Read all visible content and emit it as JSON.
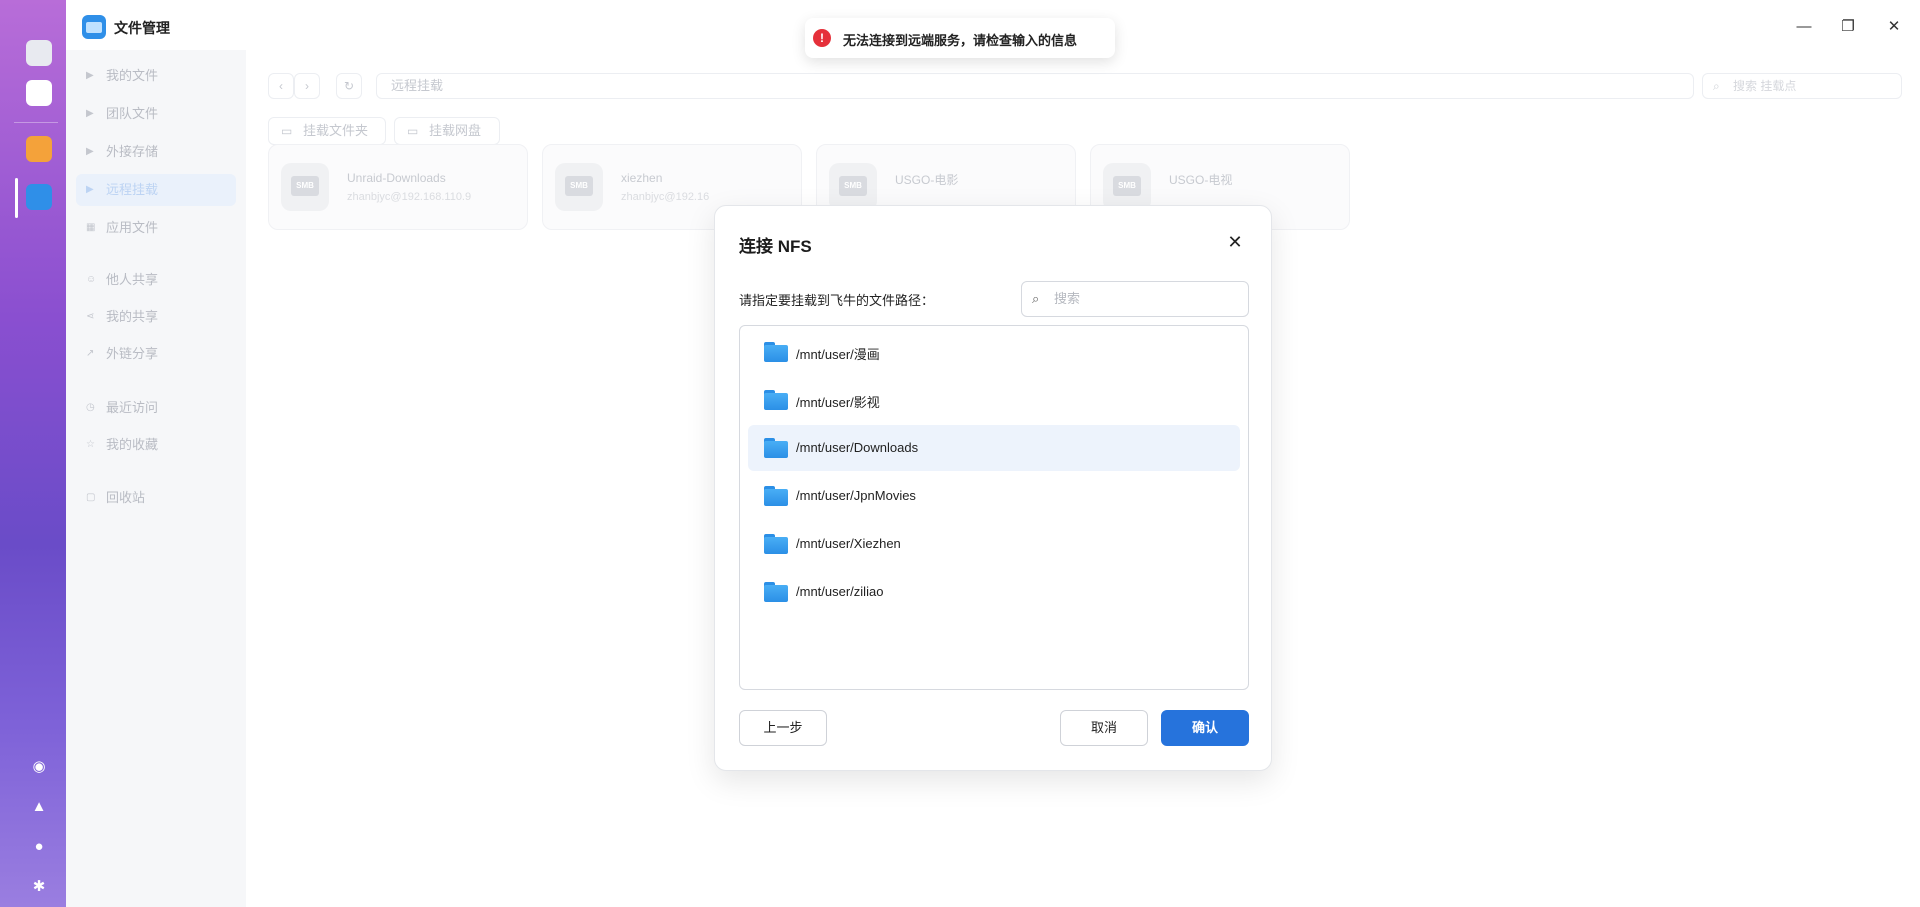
{
  "window": {
    "title": "文件管理"
  },
  "sidebar": {
    "items": [
      {
        "label": "我的文件",
        "icon": "chevron-right-icon"
      },
      {
        "label": "团队文件",
        "icon": "chevron-right-icon"
      },
      {
        "label": "外接存储",
        "icon": "chevron-right-icon"
      },
      {
        "label": "远程挂载",
        "icon": "chevron-right-icon",
        "active": true
      },
      {
        "label": "应用文件",
        "icon": "grid-icon"
      },
      {
        "label": "他人共享",
        "icon": "user-share-icon"
      },
      {
        "label": "我的共享",
        "icon": "share-icon"
      },
      {
        "label": "外链分享",
        "icon": "external-link-icon"
      },
      {
        "label": "最近访问",
        "icon": "clock-icon"
      },
      {
        "label": "我的收藏",
        "icon": "star-icon"
      },
      {
        "label": "回收站",
        "icon": "trash-icon"
      }
    ]
  },
  "toolbar": {
    "path": "远程挂载",
    "search_placeholder": "搜索 挂载点",
    "mount_folder_label": "挂载文件夹",
    "mount_netdisk_label": "挂载网盘"
  },
  "mounts": [
    {
      "name": "Unraid-Downloads",
      "sub": "zhanbjyc@192.168.110.9",
      "badge": "SMB"
    },
    {
      "name": "xiezhen",
      "sub": "zhanbjyc@192.16",
      "badge": "SMB"
    },
    {
      "name": "USGO-电影",
      "sub": "",
      "badge": "SMB"
    },
    {
      "name": "USGO-电视",
      "sub": "",
      "badge": "SMB"
    }
  ],
  "toast": {
    "message": "无法连接到远端服务，请检查输入的信息",
    "icon": "error-icon"
  },
  "dialog": {
    "title": "连接 NFS",
    "path_label": "请指定要挂载到飞牛的文件路径：",
    "search_placeholder": "搜索",
    "folders": [
      {
        "path": "/mnt/user/漫画"
      },
      {
        "path": "/mnt/user/影视"
      },
      {
        "path": "/mnt/user/Downloads",
        "selected": true
      },
      {
        "path": "/mnt/user/JpnMovies"
      },
      {
        "path": "/mnt/user/Xiezhen"
      },
      {
        "path": "/mnt/user/ziliao"
      }
    ],
    "prev_label": "上一步",
    "cancel_label": "取消",
    "confirm_label": "确认"
  },
  "colors": {
    "accent": "#2673dc",
    "error": "#e5303a",
    "folder": "#2b8fe6"
  }
}
